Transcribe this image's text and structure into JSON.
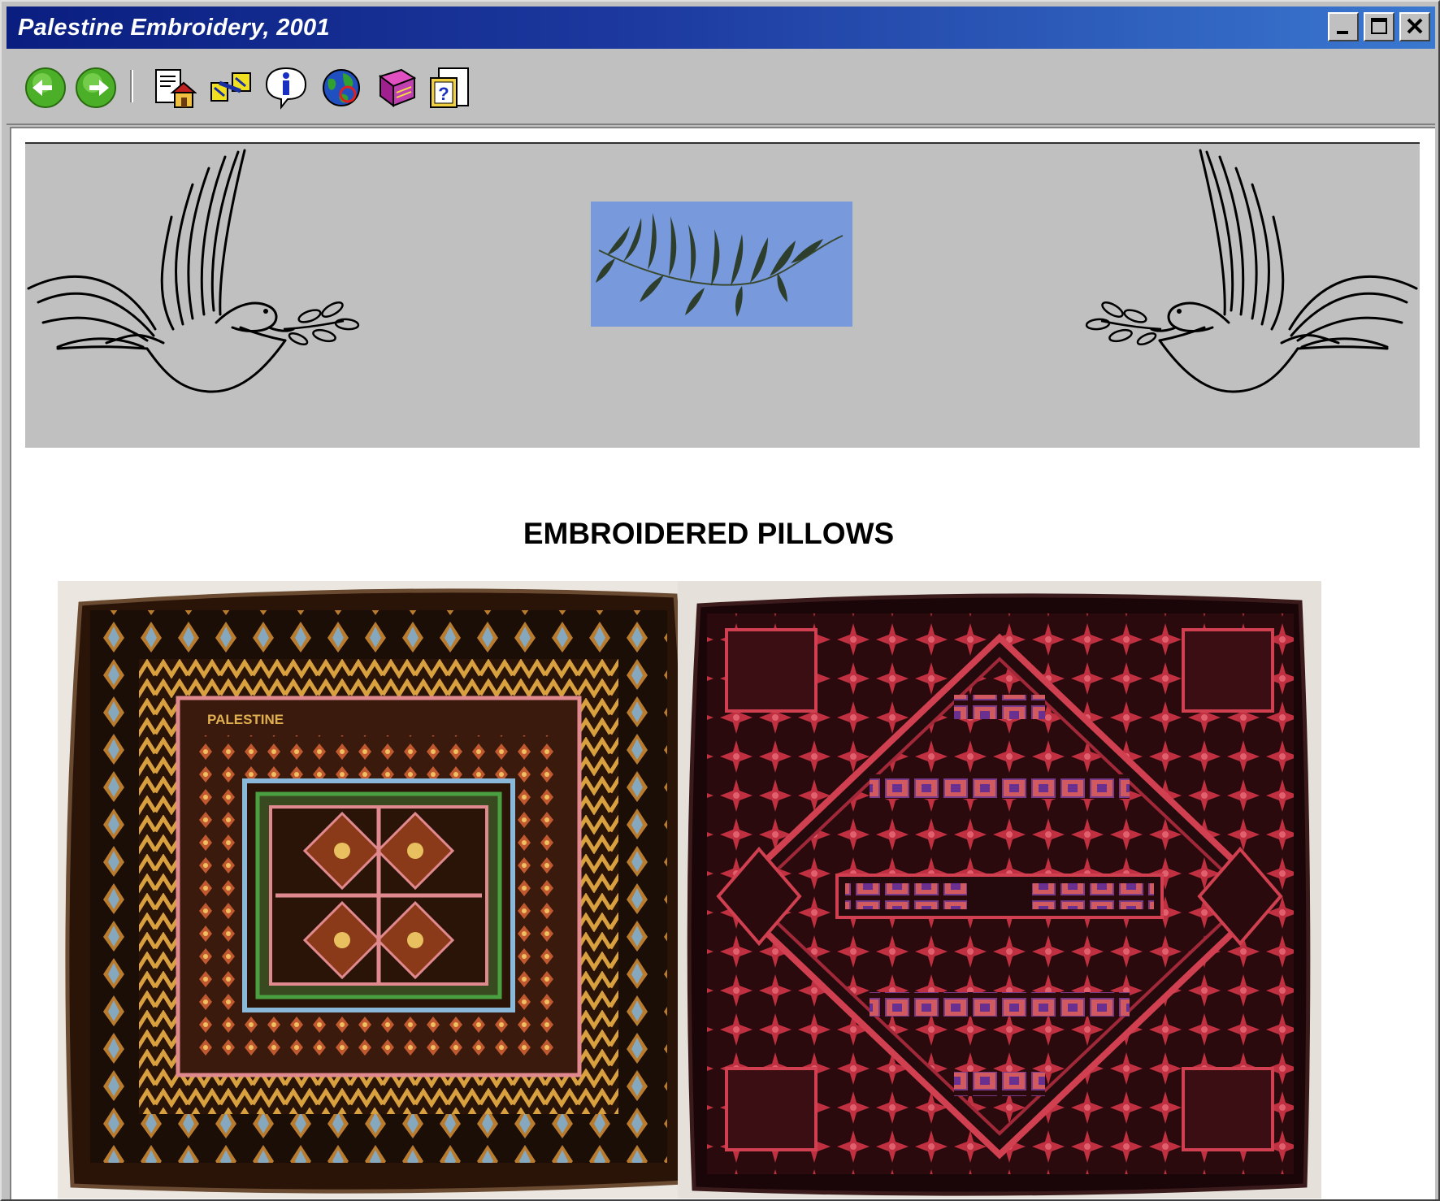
{
  "window": {
    "title": "Palestine Embroidery, 2001",
    "controls": [
      "minimize",
      "maximize",
      "close"
    ]
  },
  "toolbar": {
    "icons": [
      "back-icon",
      "forward-icon",
      "home-page-icon",
      "links-icon",
      "info-icon",
      "globe-icon",
      "book-icon",
      "help-icon"
    ]
  },
  "page": {
    "heading": "EMBROIDERED PILLOWS",
    "banner_images": [
      "dove-left",
      "olive-branch-photo",
      "dove-right"
    ],
    "photos": [
      "pillow-photo-left",
      "pillow-photo-right"
    ]
  },
  "colors": {
    "titlebar_start": "#0a1e80",
    "titlebar_end": "#3a78d0",
    "chrome": "#c0c0c0",
    "banner": "#c0c0c0",
    "olive_photo_bg": "#6f92d8",
    "pillow_left_main": "#3a1e10",
    "pillow_right_main": "#9a2a30"
  }
}
